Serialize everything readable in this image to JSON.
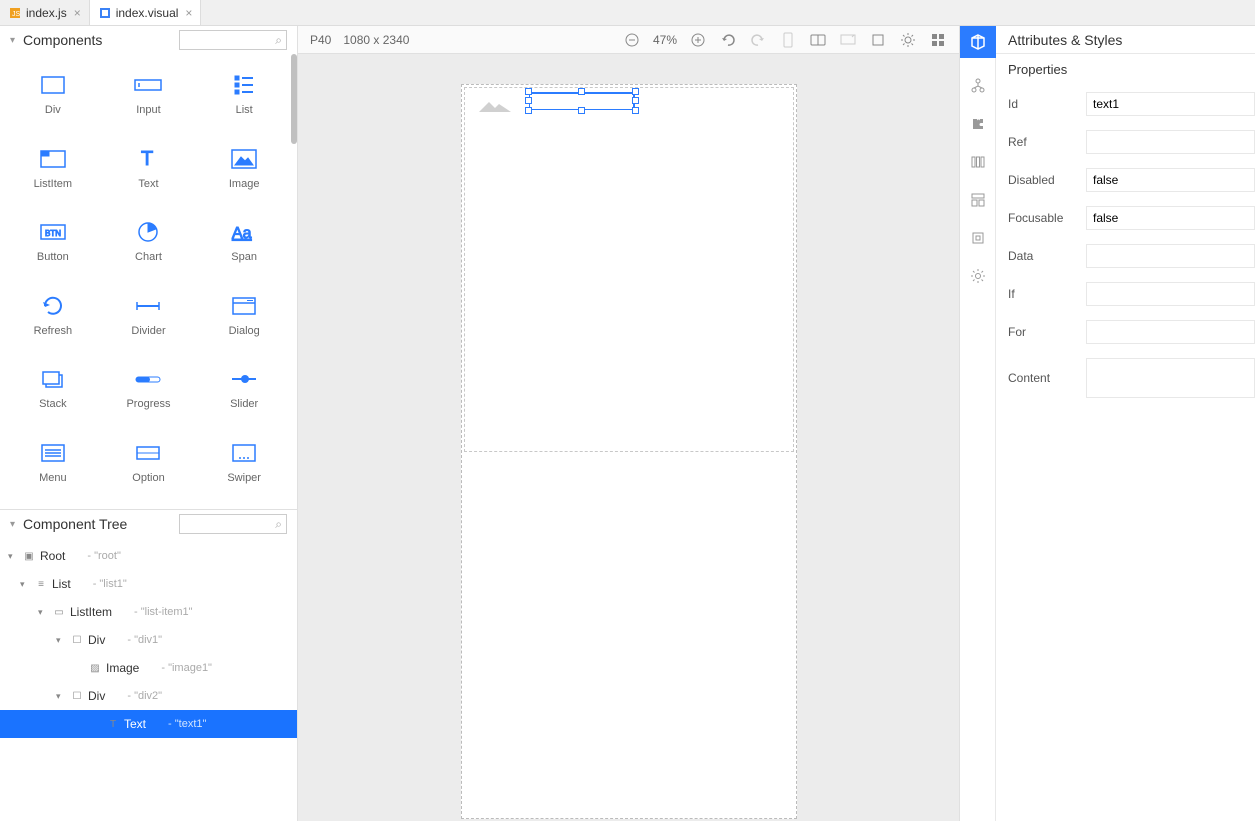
{
  "tabs": [
    {
      "label": "index.js",
      "iconColor": "#f0a020"
    },
    {
      "label": "index.visual",
      "iconColor": "#3b82f6"
    }
  ],
  "componentsPanel": {
    "title": "Components",
    "items": [
      {
        "label": "Div",
        "icon": "div"
      },
      {
        "label": "Input",
        "icon": "input"
      },
      {
        "label": "List",
        "icon": "list"
      },
      {
        "label": "ListItem",
        "icon": "listitem"
      },
      {
        "label": "Text",
        "icon": "text"
      },
      {
        "label": "Image",
        "icon": "image"
      },
      {
        "label": "Button",
        "icon": "button"
      },
      {
        "label": "Chart",
        "icon": "chart"
      },
      {
        "label": "Span",
        "icon": "span"
      },
      {
        "label": "Refresh",
        "icon": "refresh"
      },
      {
        "label": "Divider",
        "icon": "divider"
      },
      {
        "label": "Dialog",
        "icon": "dialog"
      },
      {
        "label": "Stack",
        "icon": "stack"
      },
      {
        "label": "Progress",
        "icon": "progress"
      },
      {
        "label": "Slider",
        "icon": "slider"
      },
      {
        "label": "Menu",
        "icon": "menu"
      },
      {
        "label": "Option",
        "icon": "option"
      },
      {
        "label": "Swiper",
        "icon": "swiper"
      }
    ]
  },
  "treePanel": {
    "title": "Component Tree",
    "nodes": [
      {
        "name": "Root",
        "id": "\"root\"",
        "indent": 0,
        "icon": "root",
        "expanded": true
      },
      {
        "name": "List",
        "id": "\"list1\"",
        "indent": 1,
        "icon": "list",
        "expanded": true
      },
      {
        "name": "ListItem",
        "id": "\"list-item1\"",
        "indent": 2,
        "icon": "listitem",
        "expanded": true
      },
      {
        "name": "Div",
        "id": "\"div1\"",
        "indent": 3,
        "icon": "div",
        "expanded": true
      },
      {
        "name": "Image",
        "id": "\"image1\"",
        "indent": 4,
        "icon": "image",
        "expanded": false
      },
      {
        "name": "Div",
        "id": "\"div2\"",
        "indent": 3,
        "icon": "div",
        "expanded": true
      },
      {
        "name": "Text",
        "id": "\"text1\"",
        "indent": 5,
        "icon": "text",
        "expanded": false,
        "selected": true
      }
    ]
  },
  "canvasToolbar": {
    "device": "P40",
    "resolution": "1080 x 2340",
    "zoom": "47%"
  },
  "attributesPanel": {
    "header": "Attributes & Styles",
    "section": "Properties",
    "props": [
      {
        "label": "Id",
        "value": "text1"
      },
      {
        "label": "Ref",
        "value": ""
      },
      {
        "label": "Disabled",
        "value": "false"
      },
      {
        "label": "Focusable",
        "value": "false"
      },
      {
        "label": "Data",
        "value": ""
      },
      {
        "label": "If",
        "value": ""
      },
      {
        "label": "For",
        "value": ""
      },
      {
        "label": "Content",
        "value": "",
        "textarea": true
      }
    ]
  }
}
